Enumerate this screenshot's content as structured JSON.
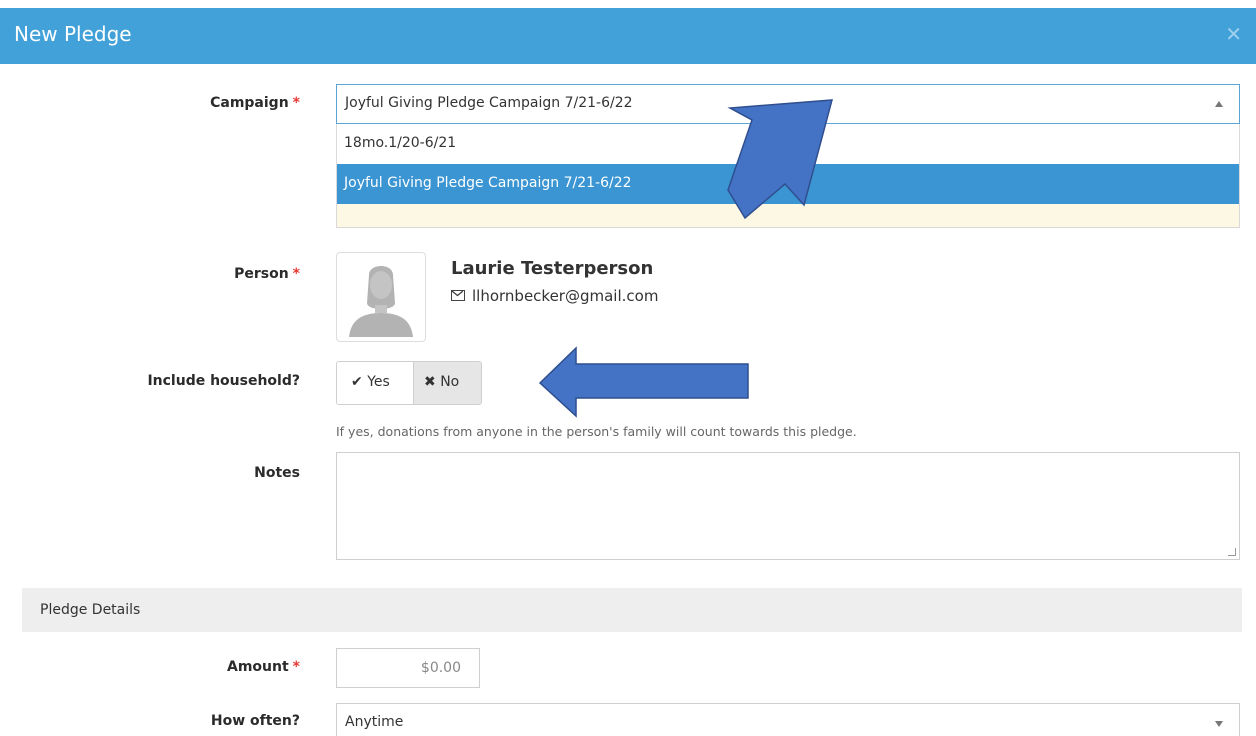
{
  "modal": {
    "title": "New Pledge",
    "close_icon": "close-icon",
    "header_color": "#42a1d8"
  },
  "campaign": {
    "label": "Campaign",
    "required_marker": "*",
    "selected": "Joyful Giving Pledge Campaign 7/21-6/22",
    "options": [
      "18mo.1/20-6/21",
      "Joyful Giving Pledge Campaign 7/21-6/22"
    ],
    "highlight_color": "#3a95d2"
  },
  "person": {
    "label": "Person",
    "required_marker": "*",
    "name": "Laurie Testerperson",
    "email": "llhornbecker@gmail.com"
  },
  "household": {
    "label": "Include household?",
    "yes_label": "Yes",
    "no_label": "No",
    "selected": "No",
    "help_text": "If yes, donations from anyone in the person's family will count towards this pledge."
  },
  "notes": {
    "label": "Notes",
    "value": ""
  },
  "pledge_details": {
    "section_title": "Pledge Details",
    "amount_label": "Amount",
    "amount_required_marker": "*",
    "amount_placeholder": "$0.00",
    "how_often_label": "How often?",
    "how_often_value": "Anytime"
  },
  "annotation_color": "#4472c4"
}
